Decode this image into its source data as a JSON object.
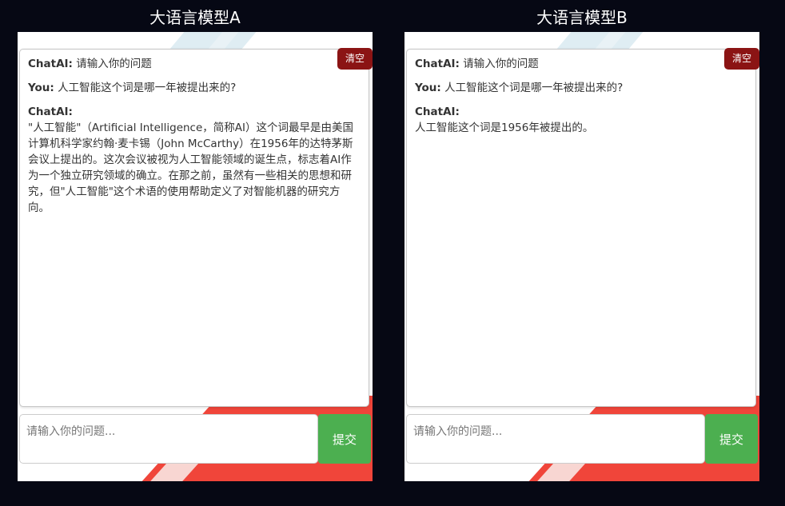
{
  "panels": [
    {
      "title": "大语言模型A",
      "clear_label": "清空",
      "messages": [
        {
          "sender": "ChatAI:",
          "text": "请输入你的问题"
        },
        {
          "sender": "You:",
          "text": "人工智能这个词是哪一年被提出来的?"
        },
        {
          "sender": "ChatAI:",
          "text": "\"人工智能\"（Artificial Intelligence，简称AI）这个词最早是由美国计算机科学家约翰·麦卡锡（John McCarthy）在1956年的达特茅斯会议上提出的。这次会议被视为人工智能领域的诞生点，标志着AI作为一个独立研究领域的确立。在那之前，虽然有一些相关的思想和研究，但\"人工智能\"这个术语的使用帮助定义了对智能机器的研究方向。"
        }
      ],
      "input_placeholder": "请输入你的问题...",
      "submit_label": "提交"
    },
    {
      "title": "大语言模型B",
      "clear_label": "清空",
      "messages": [
        {
          "sender": "ChatAI:",
          "text": "请输入你的问题"
        },
        {
          "sender": "You:",
          "text": "人工智能这个词是哪一年被提出来的?"
        },
        {
          "sender": "ChatAI:",
          "text": "人工智能这个词是1956年被提出的。"
        }
      ],
      "input_placeholder": "请输入你的问题...",
      "submit_label": "提交"
    }
  ]
}
